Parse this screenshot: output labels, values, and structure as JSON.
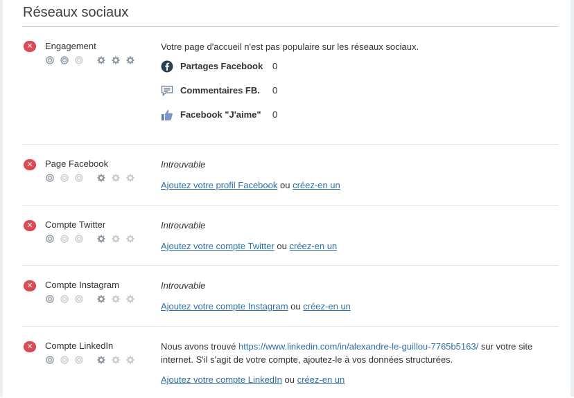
{
  "section": {
    "title": "Réseaux sociaux"
  },
  "colors": {
    "fail": "#e2474f",
    "link": "#2a6fb5",
    "icon_active": "#8e99a4",
    "icon_inactive": "#c7cdd3"
  },
  "criteria": [
    {
      "name": "Engagement",
      "status": "fail",
      "status_glyph": "✕",
      "importance_icons": [
        "target-active",
        "target-active",
        "target-inactive"
      ],
      "difficulty_icons": [
        "gear-active",
        "gear-active",
        "gear-active"
      ],
      "intro": "Votre page d'accueil n'est pas populaire sur les réseaux sociaux.",
      "stats": [
        {
          "icon": "facebook-icon",
          "label": "Partages Facebook",
          "value": "0"
        },
        {
          "icon": "comment-icon",
          "label": "Commentaires FB.",
          "value": "0"
        },
        {
          "icon": "thumbs-up-icon",
          "label": "Facebook \"J'aime\"",
          "value": "0"
        }
      ]
    },
    {
      "name": "Page Facebook",
      "status": "fail",
      "status_glyph": "✕",
      "importance_icons": [
        "target-active",
        "target-inactive",
        "target-inactive"
      ],
      "difficulty_icons": [
        "gear-active",
        "gear-inactive",
        "gear-inactive"
      ],
      "state": "Introuvable",
      "add_link": "Ajoutez votre profil Facebook",
      "or": "ou",
      "create_link": "créez-en un"
    },
    {
      "name": "Compte Twitter",
      "status": "fail",
      "status_glyph": "✕",
      "importance_icons": [
        "target-active",
        "target-inactive",
        "target-inactive"
      ],
      "difficulty_icons": [
        "gear-active",
        "gear-inactive",
        "gear-inactive"
      ],
      "state": "Introuvable",
      "add_link": "Ajoutez votre compte Twitter",
      "or": "ou",
      "create_link": "créez-en un"
    },
    {
      "name": "Compte Instagram",
      "status": "fail",
      "status_glyph": "✕",
      "importance_icons": [
        "target-active",
        "target-inactive",
        "target-inactive"
      ],
      "difficulty_icons": [
        "gear-active",
        "gear-inactive",
        "gear-inactive"
      ],
      "state": "Introuvable",
      "add_link": "Ajoutez votre compte Instagram",
      "or": "ou",
      "create_link": "créez-en un"
    },
    {
      "name": "Compte LinkedIn",
      "status": "fail",
      "status_glyph": "✕",
      "importance_icons": [
        "target-active",
        "target-inactive",
        "target-inactive"
      ],
      "difficulty_icons": [
        "gear-active",
        "gear-inactive",
        "gear-inactive"
      ],
      "msg_before": "Nous avons trouvé",
      "url": "https://www.linkedin.com/in/alexandre-le-guillou-7765b5163/",
      "msg_after": "sur votre site internet. S'il s'agit de votre compte, ajoutez-le à vos données structurées.",
      "add_link": "Ajoutez votre compte LinkedIn",
      "or": "ou",
      "create_link": "créez-en un"
    }
  ]
}
